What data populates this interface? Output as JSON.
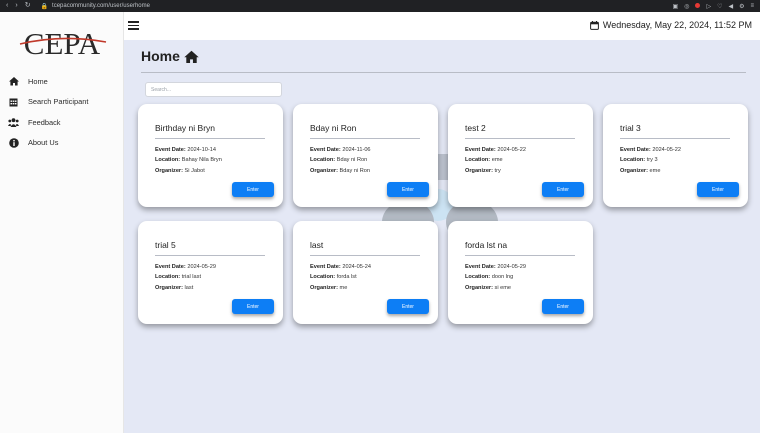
{
  "browser": {
    "url": "tcepacommunity.com/user/userhome"
  },
  "sidebar": {
    "logo_text": "CEPA",
    "items": [
      {
        "label": "Home",
        "icon": "home-icon"
      },
      {
        "label": "Search Participant",
        "icon": "calendar-icon"
      },
      {
        "label": "Feedback",
        "icon": "users-icon"
      },
      {
        "label": "About Us",
        "icon": "info-icon"
      }
    ]
  },
  "header": {
    "datetime": "Wednesday, May 22, 2024, 11:52 PM"
  },
  "main": {
    "title": "Home",
    "search_placeholder": "Search...",
    "labels": {
      "event_date": "Event Date:",
      "location": "Location:",
      "organizer": "Organizer:",
      "enter": "Enter"
    },
    "events": [
      {
        "title": "Birthday ni Bryn",
        "date": "2024-10-14",
        "location": "Bahay Nila Bryn",
        "organizer": "Si Jabot"
      },
      {
        "title": "Bday ni Ron",
        "date": "2024-11-06",
        "location": "Bday ni Ron",
        "organizer": "Bday ni Ron"
      },
      {
        "title": "test 2",
        "date": "2024-05-22",
        "location": "eme",
        "organizer": "try"
      },
      {
        "title": "trial 3",
        "date": "2024-05-22",
        "location": "try 3",
        "organizer": "eme"
      },
      {
        "title": "trial 5",
        "date": "2024-05-29",
        "location": "trial last",
        "organizer": "last"
      },
      {
        "title": "last",
        "date": "2024-05-24",
        "location": "forda lst",
        "organizer": "me"
      },
      {
        "title": "forda lst na",
        "date": "2024-05-29",
        "location": "doon lng",
        "organizer": "si eme"
      }
    ]
  },
  "colors": {
    "background": "#e4e8f5",
    "accent": "#0d7ef5",
    "logo_red": "#c0392b"
  }
}
